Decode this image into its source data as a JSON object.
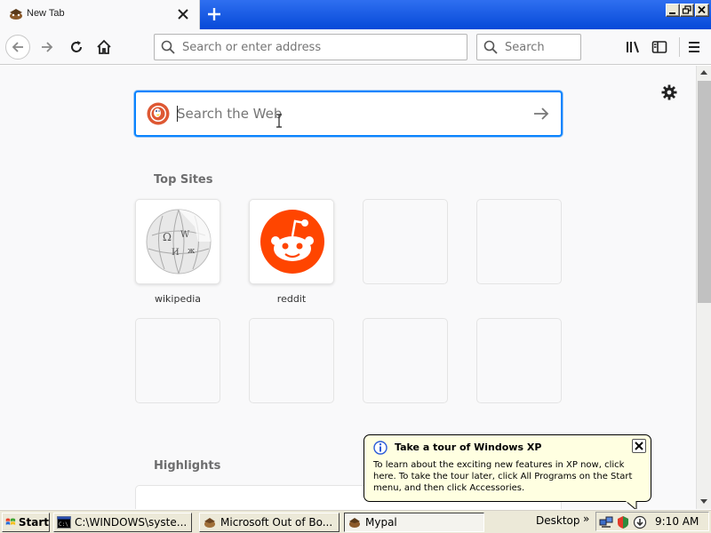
{
  "tab": {
    "title": "New Tab",
    "icon": "mypal-icon"
  },
  "window": {
    "buttons": [
      "minimize",
      "restore",
      "close"
    ]
  },
  "navbar": {
    "url_placeholder": "Search or enter address",
    "search_placeholder": "Search"
  },
  "content": {
    "web_search_placeholder": "Search the Web",
    "top_sites_title": "Top Sites",
    "top_sites": [
      {
        "label": "wikipedia",
        "icon": "wikipedia-globe-icon"
      },
      {
        "label": "reddit",
        "icon": "reddit-alien-icon"
      },
      {
        "label": ""
      },
      {
        "label": ""
      },
      {
        "label": ""
      },
      {
        "label": ""
      },
      {
        "label": ""
      },
      {
        "label": ""
      }
    ],
    "highlights_title": "Highlights"
  },
  "balloon": {
    "title": "Take a tour of Windows XP",
    "text": "To learn about the exciting new features in XP now, click here. To take the tour later, click All Programs on the Start menu, and then click Accessories."
  },
  "taskbar": {
    "start_label": "Start",
    "tasks": [
      {
        "label": "C:\\WINDOWS\\syste...",
        "icon": "cmd-icon"
      },
      {
        "label": "Microsoft Out of Bo...",
        "icon": "oobe-icon"
      },
      {
        "label": "Mypal",
        "icon": "mypal-icon",
        "active": true
      }
    ],
    "desktop_label": "Desktop",
    "chevron": "»",
    "clock": "9:10 AM"
  },
  "colors": {
    "accent": "#0a84ff",
    "titlebar": "#0a50e0",
    "reddit": "#ff4500",
    "balloon_bg": "#ffffe1"
  }
}
